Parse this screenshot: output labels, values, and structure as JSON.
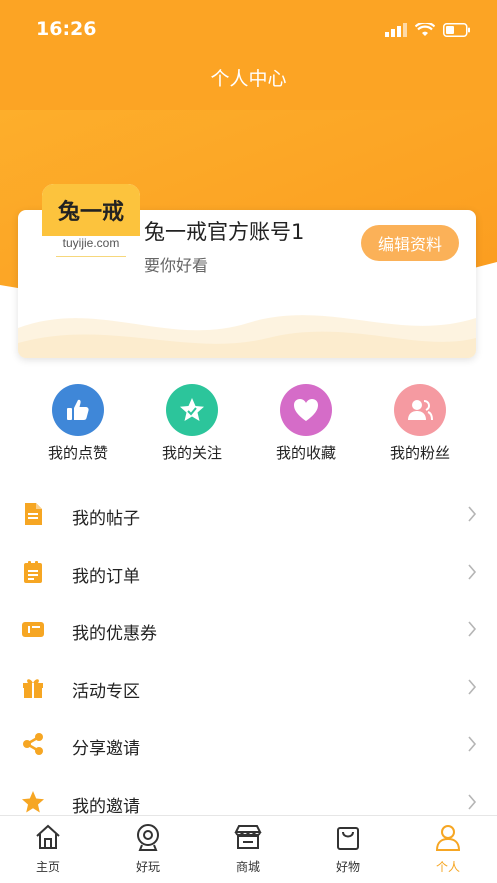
{
  "status_bar": {
    "time": "16:26"
  },
  "header": {
    "title": "个人中心"
  },
  "profile": {
    "avatar_text": "兔一戒",
    "avatar_subtext": "tuyijie.com",
    "name": "兔一戒官方账号1",
    "bio": "要你好看",
    "edit_label": "编辑资料"
  },
  "quick_actions": [
    {
      "label": "我的点赞",
      "icon": "thumbs-up-icon",
      "color": "#3f87d8"
    },
    {
      "label": "我的关注",
      "icon": "star-icon",
      "color": "#2cc59b"
    },
    {
      "label": "我的收藏",
      "icon": "heart-icon",
      "color": "#d56cc8"
    },
    {
      "label": "我的粉丝",
      "icon": "fans-icon",
      "color": "#f59aa1"
    }
  ],
  "menu": [
    {
      "label": "我的帖子",
      "icon": "document-icon"
    },
    {
      "label": "我的订单",
      "icon": "clipboard-icon"
    },
    {
      "label": "我的优惠券",
      "icon": "wallet-icon"
    },
    {
      "label": "活动专区",
      "icon": "gift-icon"
    },
    {
      "label": "分享邀请",
      "icon": "share-icon"
    },
    {
      "label": "我的邀请",
      "icon": "star-icon"
    }
  ],
  "tabs": [
    {
      "label": "主页",
      "icon": "home-icon"
    },
    {
      "label": "好玩",
      "icon": "camera-icon"
    },
    {
      "label": "商城",
      "icon": "store-icon"
    },
    {
      "label": "好物",
      "icon": "bag-icon"
    },
    {
      "label": "个人",
      "icon": "person-icon"
    }
  ],
  "colors": {
    "accent": "#f6a623",
    "header_orange": "#fca424",
    "edit_button": "#fbb158"
  }
}
